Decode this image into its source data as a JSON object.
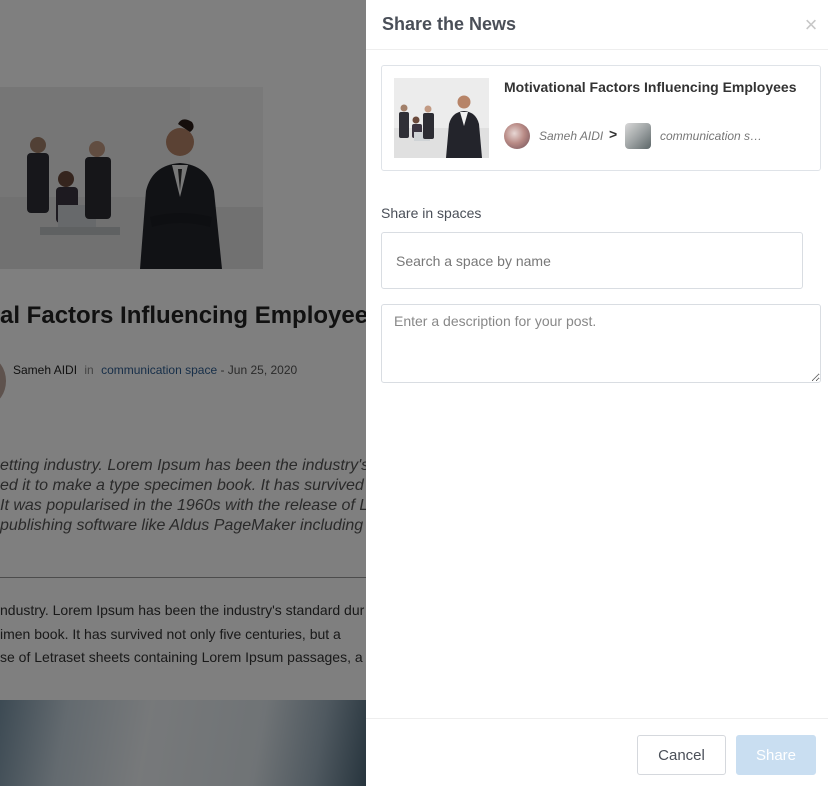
{
  "background": {
    "article_title": "al Factors Influencing Employees",
    "author": "Sameh AIDI",
    "in_label": "in",
    "space": "communication space",
    "date": "- Jun 25, 2020",
    "quote_lines": [
      "etting industry. Lorem Ipsum has been the industry's",
      "ed it to make a type specimen book. It has survived n",
      " It was popularised in the 1960s with the release of L",
      " publishing software like Aldus PageMaker including"
    ],
    "para_lines": [
      "ndustry. Lorem Ipsum has been the industry's standard dur",
      "imen book. It has survived not only five centuries, but a",
      "se of Letraset sheets containing Lorem Ipsum passages, a"
    ]
  },
  "drawer": {
    "title": "Share the News",
    "close_glyph": "×",
    "preview": {
      "title": "Motivational Factors Influencing Employees",
      "author_name": "Sameh AIDI",
      "arrow_glyph": ">",
      "space_name": "communication space"
    },
    "share_in_spaces_label": "Share in spaces",
    "space_search": {
      "value": "",
      "placeholder": "Search a space by name"
    },
    "description": {
      "value": "",
      "placeholder": "Enter a description for your post."
    },
    "cancel_label": "Cancel",
    "share_label": "Share"
  },
  "colors": {
    "overlay": "rgba(0,0,0,0.5)",
    "share_button_disabled": "#c9def1",
    "link": "#2f5e93",
    "title_text": "#4a4f58"
  }
}
